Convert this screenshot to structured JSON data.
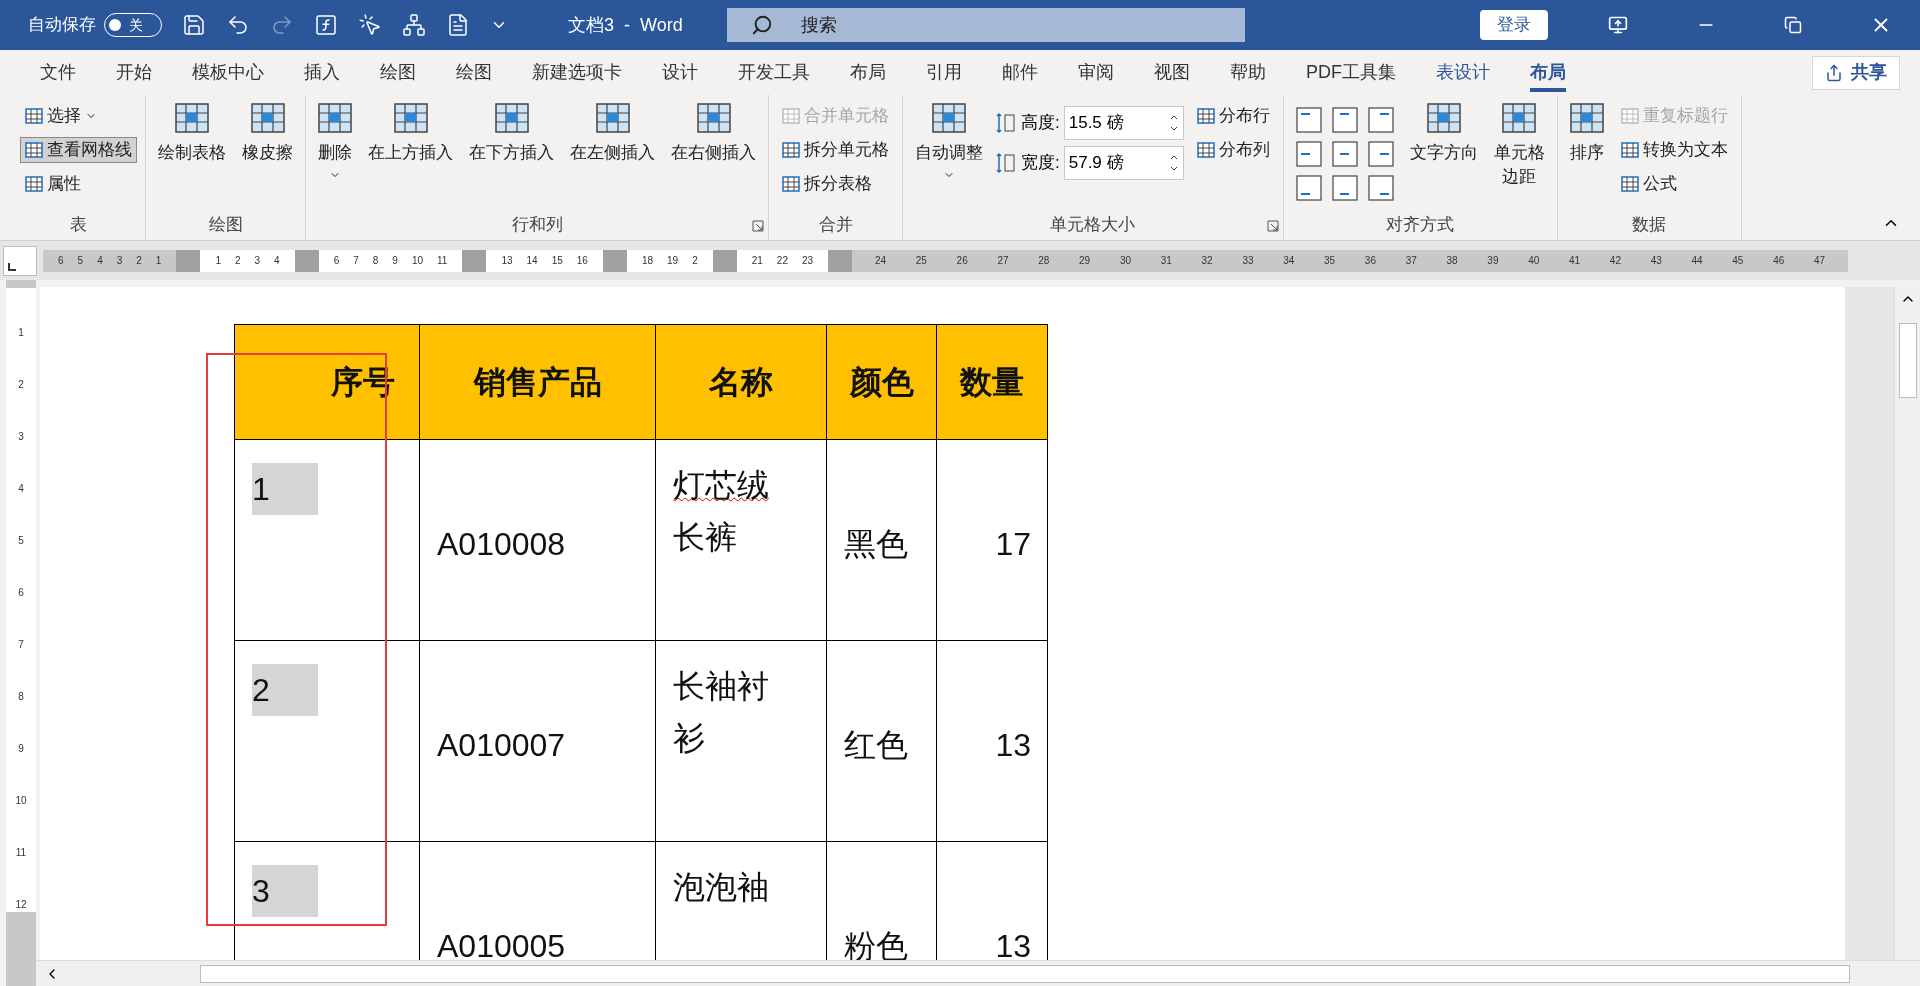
{
  "title_bar": {
    "autosave_label": "自动保存",
    "autosave": {
      "label": "关",
      "on": false
    },
    "title": "文档3  -  Word",
    "search_placeholder": "搜索",
    "login": "登录"
  },
  "tabs": [
    {
      "label": "文件",
      "selected": false,
      "kind": "normal"
    },
    {
      "label": "开始",
      "selected": false,
      "kind": "normal"
    },
    {
      "label": "模板中心",
      "selected": false,
      "kind": "normal"
    },
    {
      "label": "插入",
      "selected": false,
      "kind": "normal"
    },
    {
      "label": "绘图",
      "selected": false,
      "kind": "normal"
    },
    {
      "label": "绘图",
      "selected": false,
      "kind": "normal"
    },
    {
      "label": "新建选项卡",
      "selected": false,
      "kind": "normal"
    },
    {
      "label": "设计",
      "selected": false,
      "kind": "normal"
    },
    {
      "label": "开发工具",
      "selected": false,
      "kind": "normal"
    },
    {
      "label": "布局",
      "selected": false,
      "kind": "normal"
    },
    {
      "label": "引用",
      "selected": false,
      "kind": "normal"
    },
    {
      "label": "邮件",
      "selected": false,
      "kind": "normal"
    },
    {
      "label": "审阅",
      "selected": false,
      "kind": "normal"
    },
    {
      "label": "视图",
      "selected": false,
      "kind": "normal"
    },
    {
      "label": "帮助",
      "selected": false,
      "kind": "normal"
    },
    {
      "label": "PDF工具集",
      "selected": false,
      "kind": "normal"
    },
    {
      "label": "表设计",
      "selected": false,
      "kind": "contextual"
    },
    {
      "label": "布局",
      "selected": true,
      "kind": "contextual"
    }
  ],
  "share": "共享",
  "ribbon_groups": [
    {
      "label": "表",
      "launcher": false,
      "columns": [
        [
          {
            "kind": "small",
            "label": "选择",
            "dropdown": true,
            "disabled": false,
            "selected": false
          },
          {
            "kind": "small",
            "label": "查看网格线",
            "dropdown": false,
            "disabled": false,
            "selected": true
          },
          {
            "kind": "small",
            "label": "属性",
            "dropdown": false,
            "disabled": false,
            "selected": false
          }
        ]
      ]
    },
    {
      "label": "绘图",
      "launcher": false,
      "columns": [
        [
          {
            "kind": "large",
            "label": "绘制表格",
            "dropdown": false,
            "disabled": false
          }
        ],
        [
          {
            "kind": "large",
            "label": "橡皮擦",
            "dropdown": false,
            "disabled": false
          }
        ]
      ]
    },
    {
      "label": "行和列",
      "launcher": true,
      "columns": [
        [
          {
            "kind": "large",
            "label": "删除",
            "dropdown": true,
            "disabled": false
          }
        ],
        [
          {
            "kind": "large",
            "label": "在上方插入",
            "dropdown": false,
            "disabled": false
          }
        ],
        [
          {
            "kind": "large",
            "label": "在下方插入",
            "dropdown": false,
            "disabled": false
          }
        ],
        [
          {
            "kind": "large",
            "label": "在左侧插入",
            "dropdown": false,
            "disabled": false
          }
        ],
        [
          {
            "kind": "large",
            "label": "在右侧插入",
            "dropdown": false,
            "disabled": false
          }
        ]
      ]
    },
    {
      "label": "合并",
      "launcher": false,
      "columns": [
        [
          {
            "kind": "small",
            "label": "合并单元格",
            "dropdown": false,
            "disabled": true,
            "selected": false
          },
          {
            "kind": "small",
            "label": "拆分单元格",
            "dropdown": false,
            "disabled": false,
            "selected": false
          },
          {
            "kind": "small",
            "label": "拆分表格",
            "dropdown": false,
            "disabled": false,
            "selected": false
          }
        ]
      ]
    },
    {
      "label": "单元格大小",
      "launcher": true,
      "columns": [
        [
          {
            "kind": "large",
            "label": "自动调整",
            "dropdown": true,
            "disabled": false
          }
        ],
        [
          {
            "kind": "field",
            "label": "高度:",
            "value": "15.5 磅"
          },
          {
            "kind": "field",
            "label": "宽度:",
            "value": "57.9 磅"
          }
        ],
        [
          {
            "kind": "small",
            "label": "分布行",
            "dropdown": false,
            "disabled": false,
            "selected": false
          },
          {
            "kind": "small",
            "label": "分布列",
            "dropdown": false,
            "disabled": false,
            "selected": false
          }
        ]
      ]
    },
    {
      "label": "对齐方式",
      "launcher": false,
      "columns": [
        [
          {
            "kind": "align_grid"
          }
        ],
        [
          {
            "kind": "large",
            "label": "文字方向",
            "dropdown": false,
            "disabled": false
          }
        ],
        [
          {
            "kind": "large",
            "label": [
              "单元格",
              "边距"
            ],
            "dropdown": false,
            "disabled": false
          }
        ]
      ]
    },
    {
      "label": "数据",
      "launcher": false,
      "columns": [
        [
          {
            "kind": "large",
            "label": "排序",
            "dropdown": false,
            "disabled": false
          }
        ],
        [
          {
            "kind": "small",
            "label": "重复标题行",
            "dropdown": false,
            "disabled": true,
            "selected": false
          },
          {
            "kind": "small",
            "label": "转换为文本",
            "dropdown": false,
            "disabled": false,
            "selected": false
          },
          {
            "kind": "small",
            "label": "公式",
            "dropdown": false,
            "disabled": false,
            "selected": false
          }
        ]
      ]
    }
  ],
  "ruler": {
    "segments": [
      {
        "kind": "margin",
        "labels": [
          "6",
          "5",
          "4",
          "3",
          "2",
          "1"
        ]
      },
      {
        "kind": "marker"
      },
      {
        "kind": "text",
        "labels": [
          "1",
          "2",
          "3",
          "4"
        ]
      },
      {
        "kind": "marker"
      },
      {
        "kind": "text",
        "labels": [
          "6",
          "7",
          "8",
          "9",
          "10",
          "11"
        ]
      },
      {
        "kind": "marker"
      },
      {
        "kind": "text",
        "labels": [
          "13",
          "14",
          "15",
          "16"
        ]
      },
      {
        "kind": "marker"
      },
      {
        "kind": "text",
        "labels": [
          "18",
          "19",
          "2"
        ]
      },
      {
        "kind": "marker"
      },
      {
        "kind": "text",
        "labels": [
          "21",
          "22",
          "23"
        ]
      },
      {
        "kind": "marker"
      },
      {
        "kind": "margin",
        "labels": [
          "24",
          "25",
          "26",
          "27",
          "28",
          "29",
          "30",
          "31",
          "32",
          "33",
          "34",
          "35",
          "36",
          "37",
          "38",
          "39",
          "40",
          "41",
          "42",
          "43",
          "44",
          "45",
          "46",
          "47"
        ]
      }
    ],
    "vertical_labels": [
      "1",
      "2",
      "3",
      "4",
      "5",
      "6",
      "7",
      "8",
      "9",
      "10",
      "11",
      "12"
    ]
  },
  "table": {
    "columns": [
      "序号",
      "销售产品",
      "名称",
      "颜色",
      "数量"
    ],
    "rows": [
      {
        "number": "1",
        "selected": true,
        "product": "A010008",
        "name": [
          "灯芯绒",
          "长裤"
        ],
        "name_misspelled": true,
        "shade": "黑色",
        "quantity": "17"
      },
      {
        "number": "2",
        "selected": true,
        "product": "A010007",
        "name": [
          "长袖衬",
          "衫"
        ],
        "name_misspelled": false,
        "shade": "红色",
        "quantity": "13"
      },
      {
        "number": "3",
        "selected": true,
        "product": "A010005",
        "name": [
          "泡泡袖"
        ],
        "name_misspelled": false,
        "shade": "粉色",
        "quantity": "13"
      }
    ]
  }
}
